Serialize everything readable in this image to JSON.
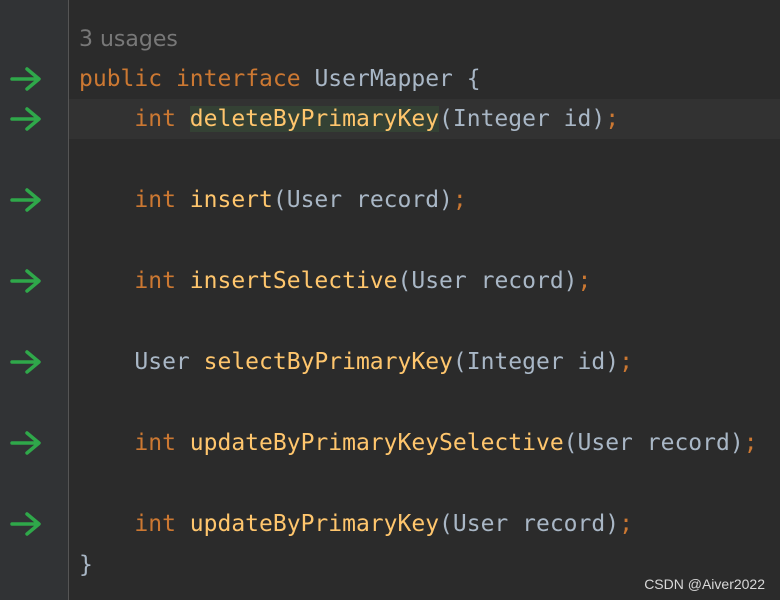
{
  "usage_hint": "3 usages",
  "interface_decl": {
    "modifier": "public",
    "keyword": "interface",
    "name": "UserMapper",
    "open_brace": "{"
  },
  "methods": [
    {
      "return_type": "int",
      "name": "deleteByPrimaryKey",
      "params": "(Integer id)",
      "end": ";"
    },
    {
      "return_type": "int",
      "name": "insert",
      "params": "(User record)",
      "end": ";"
    },
    {
      "return_type": "int",
      "name": "insertSelective",
      "params": "(User record)",
      "end": ";"
    },
    {
      "return_type": "User",
      "name": "selectByPrimaryKey",
      "params": "(Integer id)",
      "end": ";"
    },
    {
      "return_type": "int",
      "name": "updateByPrimaryKeySelective",
      "params": "(User record)",
      "end": ";"
    },
    {
      "return_type": "int",
      "name": "updateByPrimaryKey",
      "params": "(User record)",
      "end": ";"
    }
  ],
  "close_brace": "}",
  "gutter_icon": "implemented-arrow-icon",
  "colors": {
    "background": "#2b2b2b",
    "gutter": "#313335",
    "keyword": "#cc7832",
    "identifier": "#a9b7c6",
    "method": "#ffc66d",
    "hint": "#787878",
    "arrow": "#499c54"
  },
  "watermark": "CSDN @Aiver2022"
}
